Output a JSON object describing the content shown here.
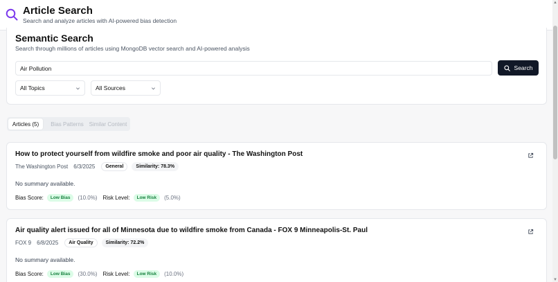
{
  "header": {
    "title": "Article Search",
    "subtitle": "Search and analyze articles with AI-powered bias detection",
    "logo_icon": "search-icon",
    "accent": "#7c3aed"
  },
  "search": {
    "title": "Semantic Search",
    "description": "Search through millions of articles using MongoDB vector search and AI-powered analysis",
    "query": "Air Pollution",
    "button_label": "Search",
    "topic_filter": "All Topics",
    "source_filter": "All Sources"
  },
  "tabs": [
    {
      "label": "Articles (5)",
      "active": true
    },
    {
      "label": "Bias Patterns",
      "active": false
    },
    {
      "label": "Similar Content",
      "active": false
    }
  ],
  "articles": [
    {
      "title": "How to protect yourself from wildfire smoke and poor air quality - The Washington Post",
      "source": "The Washington Post",
      "date": "6/3/2025",
      "topic": "General",
      "similarity": "Similarity: 78.3%",
      "summary": "No summary available.",
      "bias_label": "Bias Score:",
      "bias_badge": "Low Bias",
      "bias_pct": "(10.0%)",
      "risk_label": "Risk Level:",
      "risk_badge": "Low Risk",
      "risk_pct": "(5.0%)"
    },
    {
      "title": "Air quality alert issued for all of Minnesota due to wildfire smoke from Canada - FOX 9 Minneapolis-St. Paul",
      "source": "FOX 9",
      "date": "6/8/2025",
      "topic": "Air Quality",
      "similarity": "Similarity: 72.2%",
      "summary": "No summary available.",
      "bias_label": "Bias Score:",
      "bias_badge": "Low Bias",
      "bias_pct": "(30.0%)",
      "risk_label": "Risk Level:",
      "risk_badge": "Low Risk",
      "risk_pct": "(10.0%)"
    }
  ]
}
